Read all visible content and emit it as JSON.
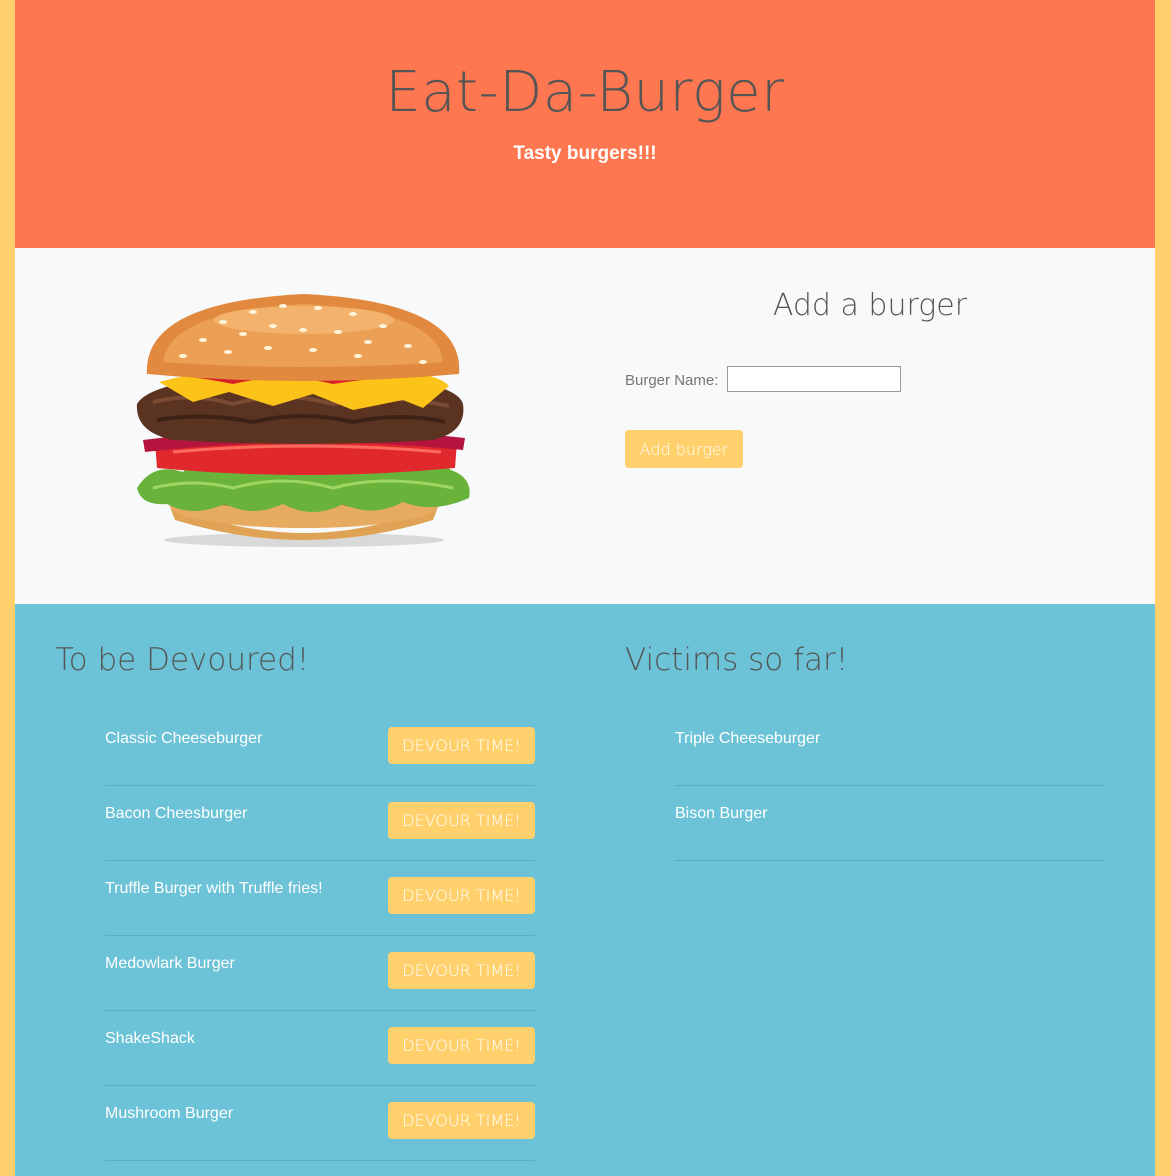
{
  "header": {
    "title": "Eat-Da-Burger",
    "tagline": "Tasty burgers!!!"
  },
  "add_form": {
    "title": "Add a burger",
    "field_label": "Burger Name:",
    "field_value": "",
    "submit_label": "Add burger"
  },
  "to_devour": {
    "title": "To be Devoured!",
    "button_label": "DEVOUR TIME!",
    "items": [
      "Classic Cheeseburger",
      "Bacon Cheesburger",
      "Truffle Burger with Truffle fries!",
      "Medowlark Burger",
      "ShakeShack",
      "Mushroom Burger"
    ]
  },
  "devoured": {
    "title": "Victims so far!",
    "items": [
      "Triple Cheeseburger",
      "Bison Burger"
    ]
  },
  "colors": {
    "page_border": "#ffd06b",
    "hero_background": "#ff7750",
    "form_background": "#f8f9fa",
    "lists_background": "#6cc2d6",
    "button_background": "#ffd06b"
  },
  "icons": {
    "burger_image": "burger-image"
  }
}
